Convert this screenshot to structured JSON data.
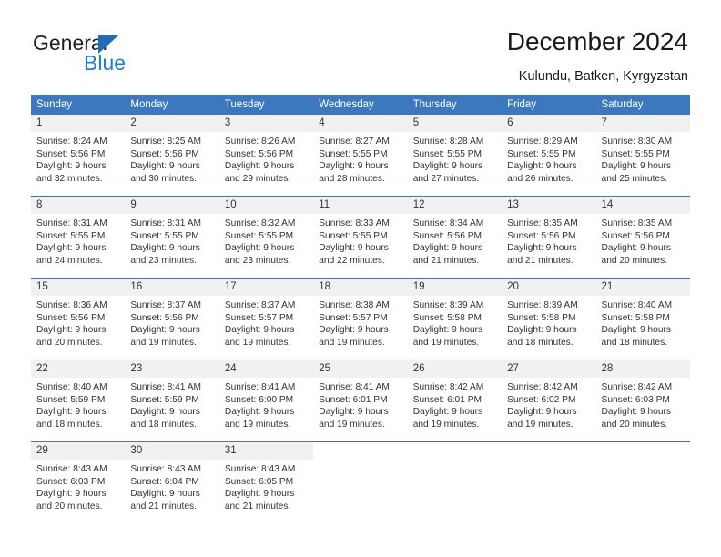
{
  "brand": {
    "name_part1": "General",
    "name_part2": "Blue",
    "triangle_icon": "triangle-logo-icon",
    "accent_color": "#1c7fd4"
  },
  "header": {
    "title": "December 2024",
    "location": "Kulundu, Batken, Kyrgyzstan"
  },
  "theme": {
    "header_bg": "#3b78bd",
    "daynum_bg": "#f1f1f1",
    "text_color": "#333333",
    "grid_line": "#3b78bd"
  },
  "calendar": {
    "weekday_headers": [
      "Sunday",
      "Monday",
      "Tuesday",
      "Wednesday",
      "Thursday",
      "Friday",
      "Saturday"
    ],
    "weeks": [
      [
        {
          "day": "1",
          "sunrise": "Sunrise: 8:24 AM",
          "sunset": "Sunset: 5:56 PM",
          "daylight1": "Daylight: 9 hours",
          "daylight2": "and 32 minutes."
        },
        {
          "day": "2",
          "sunrise": "Sunrise: 8:25 AM",
          "sunset": "Sunset: 5:56 PM",
          "daylight1": "Daylight: 9 hours",
          "daylight2": "and 30 minutes."
        },
        {
          "day": "3",
          "sunrise": "Sunrise: 8:26 AM",
          "sunset": "Sunset: 5:56 PM",
          "daylight1": "Daylight: 9 hours",
          "daylight2": "and 29 minutes."
        },
        {
          "day": "4",
          "sunrise": "Sunrise: 8:27 AM",
          "sunset": "Sunset: 5:55 PM",
          "daylight1": "Daylight: 9 hours",
          "daylight2": "and 28 minutes."
        },
        {
          "day": "5",
          "sunrise": "Sunrise: 8:28 AM",
          "sunset": "Sunset: 5:55 PM",
          "daylight1": "Daylight: 9 hours",
          "daylight2": "and 27 minutes."
        },
        {
          "day": "6",
          "sunrise": "Sunrise: 8:29 AM",
          "sunset": "Sunset: 5:55 PM",
          "daylight1": "Daylight: 9 hours",
          "daylight2": "and 26 minutes."
        },
        {
          "day": "7",
          "sunrise": "Sunrise: 8:30 AM",
          "sunset": "Sunset: 5:55 PM",
          "daylight1": "Daylight: 9 hours",
          "daylight2": "and 25 minutes."
        }
      ],
      [
        {
          "day": "8",
          "sunrise": "Sunrise: 8:31 AM",
          "sunset": "Sunset: 5:55 PM",
          "daylight1": "Daylight: 9 hours",
          "daylight2": "and 24 minutes."
        },
        {
          "day": "9",
          "sunrise": "Sunrise: 8:31 AM",
          "sunset": "Sunset: 5:55 PM",
          "daylight1": "Daylight: 9 hours",
          "daylight2": "and 23 minutes."
        },
        {
          "day": "10",
          "sunrise": "Sunrise: 8:32 AM",
          "sunset": "Sunset: 5:55 PM",
          "daylight1": "Daylight: 9 hours",
          "daylight2": "and 23 minutes."
        },
        {
          "day": "11",
          "sunrise": "Sunrise: 8:33 AM",
          "sunset": "Sunset: 5:55 PM",
          "daylight1": "Daylight: 9 hours",
          "daylight2": "and 22 minutes."
        },
        {
          "day": "12",
          "sunrise": "Sunrise: 8:34 AM",
          "sunset": "Sunset: 5:56 PM",
          "daylight1": "Daylight: 9 hours",
          "daylight2": "and 21 minutes."
        },
        {
          "day": "13",
          "sunrise": "Sunrise: 8:35 AM",
          "sunset": "Sunset: 5:56 PM",
          "daylight1": "Daylight: 9 hours",
          "daylight2": "and 21 minutes."
        },
        {
          "day": "14",
          "sunrise": "Sunrise: 8:35 AM",
          "sunset": "Sunset: 5:56 PM",
          "daylight1": "Daylight: 9 hours",
          "daylight2": "and 20 minutes."
        }
      ],
      [
        {
          "day": "15",
          "sunrise": "Sunrise: 8:36 AM",
          "sunset": "Sunset: 5:56 PM",
          "daylight1": "Daylight: 9 hours",
          "daylight2": "and 20 minutes."
        },
        {
          "day": "16",
          "sunrise": "Sunrise: 8:37 AM",
          "sunset": "Sunset: 5:56 PM",
          "daylight1": "Daylight: 9 hours",
          "daylight2": "and 19 minutes."
        },
        {
          "day": "17",
          "sunrise": "Sunrise: 8:37 AM",
          "sunset": "Sunset: 5:57 PM",
          "daylight1": "Daylight: 9 hours",
          "daylight2": "and 19 minutes."
        },
        {
          "day": "18",
          "sunrise": "Sunrise: 8:38 AM",
          "sunset": "Sunset: 5:57 PM",
          "daylight1": "Daylight: 9 hours",
          "daylight2": "and 19 minutes."
        },
        {
          "day": "19",
          "sunrise": "Sunrise: 8:39 AM",
          "sunset": "Sunset: 5:58 PM",
          "daylight1": "Daylight: 9 hours",
          "daylight2": "and 19 minutes."
        },
        {
          "day": "20",
          "sunrise": "Sunrise: 8:39 AM",
          "sunset": "Sunset: 5:58 PM",
          "daylight1": "Daylight: 9 hours",
          "daylight2": "and 18 minutes."
        },
        {
          "day": "21",
          "sunrise": "Sunrise: 8:40 AM",
          "sunset": "Sunset: 5:58 PM",
          "daylight1": "Daylight: 9 hours",
          "daylight2": "and 18 minutes."
        }
      ],
      [
        {
          "day": "22",
          "sunrise": "Sunrise: 8:40 AM",
          "sunset": "Sunset: 5:59 PM",
          "daylight1": "Daylight: 9 hours",
          "daylight2": "and 18 minutes."
        },
        {
          "day": "23",
          "sunrise": "Sunrise: 8:41 AM",
          "sunset": "Sunset: 5:59 PM",
          "daylight1": "Daylight: 9 hours",
          "daylight2": "and 18 minutes."
        },
        {
          "day": "24",
          "sunrise": "Sunrise: 8:41 AM",
          "sunset": "Sunset: 6:00 PM",
          "daylight1": "Daylight: 9 hours",
          "daylight2": "and 19 minutes."
        },
        {
          "day": "25",
          "sunrise": "Sunrise: 8:41 AM",
          "sunset": "Sunset: 6:01 PM",
          "daylight1": "Daylight: 9 hours",
          "daylight2": "and 19 minutes."
        },
        {
          "day": "26",
          "sunrise": "Sunrise: 8:42 AM",
          "sunset": "Sunset: 6:01 PM",
          "daylight1": "Daylight: 9 hours",
          "daylight2": "and 19 minutes."
        },
        {
          "day": "27",
          "sunrise": "Sunrise: 8:42 AM",
          "sunset": "Sunset: 6:02 PM",
          "daylight1": "Daylight: 9 hours",
          "daylight2": "and 19 minutes."
        },
        {
          "day": "28",
          "sunrise": "Sunrise: 8:42 AM",
          "sunset": "Sunset: 6:03 PM",
          "daylight1": "Daylight: 9 hours",
          "daylight2": "and 20 minutes."
        }
      ],
      [
        {
          "day": "29",
          "sunrise": "Sunrise: 8:43 AM",
          "sunset": "Sunset: 6:03 PM",
          "daylight1": "Daylight: 9 hours",
          "daylight2": "and 20 minutes."
        },
        {
          "day": "30",
          "sunrise": "Sunrise: 8:43 AM",
          "sunset": "Sunset: 6:04 PM",
          "daylight1": "Daylight: 9 hours",
          "daylight2": "and 21 minutes."
        },
        {
          "day": "31",
          "sunrise": "Sunrise: 8:43 AM",
          "sunset": "Sunset: 6:05 PM",
          "daylight1": "Daylight: 9 hours",
          "daylight2": "and 21 minutes."
        },
        {
          "day": "",
          "sunrise": "",
          "sunset": "",
          "daylight1": "",
          "daylight2": ""
        },
        {
          "day": "",
          "sunrise": "",
          "sunset": "",
          "daylight1": "",
          "daylight2": ""
        },
        {
          "day": "",
          "sunrise": "",
          "sunset": "",
          "daylight1": "",
          "daylight2": ""
        },
        {
          "day": "",
          "sunrise": "",
          "sunset": "",
          "daylight1": "",
          "daylight2": ""
        }
      ]
    ]
  }
}
